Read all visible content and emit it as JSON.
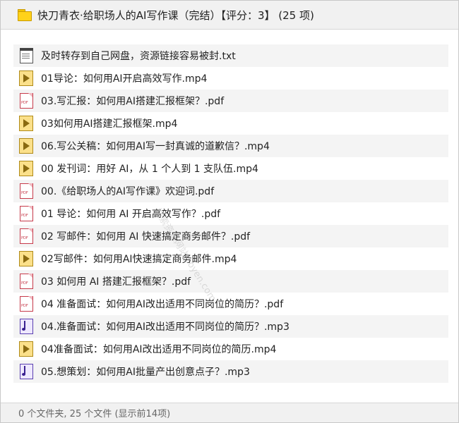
{
  "header": {
    "title": "快刀青衣·给职场人的AI写作课（完结）【评分：3】 (25 项)",
    "icon": "folder-icon"
  },
  "files": [
    {
      "name": "及时转存到自己网盘，资源链接容易被封.txt",
      "type": "txt"
    },
    {
      "name": "01导论：如何用AI开启高效写作.mp4",
      "type": "mp4"
    },
    {
      "name": "03.写汇报：如何用AI搭建汇报框架？.pdf",
      "type": "pdf"
    },
    {
      "name": "03如何用AI搭建汇报框架.mp4",
      "type": "mp4"
    },
    {
      "name": "06.写公关稿：如何用AI写一封真诚的道歉信？.mp4",
      "type": "mp4"
    },
    {
      "name": "00 发刊词：用好 AI，从 1 个人到 1 支队伍.mp4",
      "type": "mp4"
    },
    {
      "name": "00.《给职场人的AI写作课》欢迎词.pdf",
      "type": "pdf"
    },
    {
      "name": "01  导论：如何用 AI 开启高效写作？.pdf",
      "type": "pdf"
    },
    {
      "name": "02  写邮件：如何用 AI 快速搞定商务邮件？.pdf",
      "type": "pdf"
    },
    {
      "name": "02写邮件：如何用AI快速搞定商务邮件.mp4",
      "type": "mp4"
    },
    {
      "name": "03  如何用 AI 搭建汇报框架？.pdf",
      "type": "pdf"
    },
    {
      "name": "04 准备面试：如何用AI改出适用不同岗位的简历？.pdf",
      "type": "pdf"
    },
    {
      "name": "04.准备面试：如何用AI改出适用不同岗位的简历？.mp3",
      "type": "mp3"
    },
    {
      "name": "04准备面试：如何用AI改出适用不同岗位的简历.mp4",
      "type": "mp4"
    },
    {
      "name": "05.想策划：如何用AI批量产出创意点子？.mp3",
      "type": "mp3"
    }
  ],
  "pdf_badge": "PDF",
  "watermark": "搜索资源网站 soyen.com",
  "status": {
    "text": "0 个文件夹, 25 个文件 (显示前14项)"
  }
}
